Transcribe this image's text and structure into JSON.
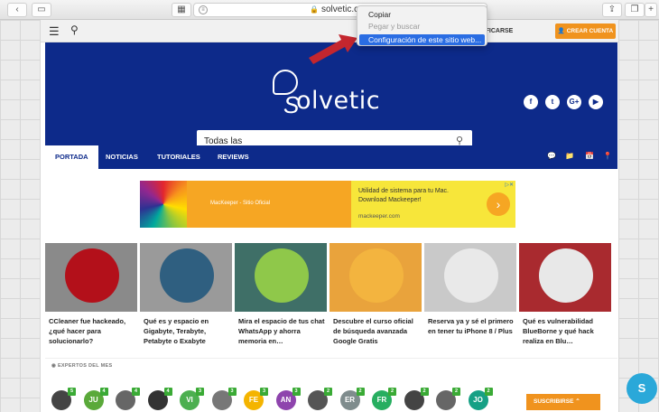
{
  "browser": {
    "url": "solvetic.com",
    "context_menu": {
      "items": [
        {
          "label": "Copiar",
          "state": "normal"
        },
        {
          "label": "Pegar y buscar",
          "state": "disabled"
        },
        {
          "label": "Configuración de este sitio web...",
          "state": "highlighted"
        }
      ]
    }
  },
  "topbar": {
    "login_label": "IDENTIFICARSE",
    "register_label": "CREAR CUENTA"
  },
  "hero": {
    "logo_text": "olvetic",
    "logo_initial": "S",
    "search_value": "Todas las",
    "social": [
      {
        "icon": "facebook-icon",
        "glyph": "f"
      },
      {
        "icon": "twitter-icon",
        "glyph": "t"
      },
      {
        "icon": "googleplus-icon",
        "glyph": "G+"
      },
      {
        "icon": "youtube-icon",
        "glyph": "▶"
      }
    ]
  },
  "nav": {
    "items": [
      "PORTADA",
      "NOTICIAS",
      "TUTORIALES",
      "REVIEWS"
    ]
  },
  "ad": {
    "brand": "MacKeeper - Sitio Oficial",
    "line1": "Utilidad de sistema para tu Mac.",
    "line2": "Download Mackeeper!",
    "line3": "mackeeper.com",
    "arrow": "›"
  },
  "cards": [
    {
      "title": "CCleaner fue hackeado, ¿qué hacer para solucionarlo?",
      "bg": "#8a8a8a",
      "circle": "#b3101a"
    },
    {
      "title": "Qué es y espacio en Gigabyte, Terabyte, Petabyte o Exabyte",
      "bg": "#9a9a9a",
      "circle": "#2f5f80"
    },
    {
      "title": "Mira el espacio de tus chat WhatsApp y ahorra memoria en…",
      "bg": "#3f6f67",
      "circle": "#8fc84a"
    },
    {
      "title": "Descubre el curso oficial de búsqueda avanzada Google Gratis",
      "bg": "#e9a33c",
      "circle": "#f3b43f"
    },
    {
      "title": "Reserva ya y sé el primero en tener tu iPhone 8 / Plus",
      "bg": "#c9c9c9",
      "circle": "#e9e9e9"
    },
    {
      "title": "Qué es vulnerabilidad BlueBorne y qué hack realiza en Blu…",
      "bg": "#a92a2f",
      "circle": "#e8e8e8"
    }
  ],
  "experts": {
    "title": "EXPERTOS DEL MES",
    "members": [
      {
        "initials": "",
        "color": "#444",
        "count": "5"
      },
      {
        "initials": "JU",
        "color": "#5aa93a",
        "count": "4"
      },
      {
        "initials": "",
        "color": "#666",
        "count": "4"
      },
      {
        "initials": "",
        "color": "#333",
        "count": "4"
      },
      {
        "initials": "VI",
        "color": "#4caf50",
        "count": "3"
      },
      {
        "initials": "",
        "color": "#777",
        "count": "3"
      },
      {
        "initials": "FE",
        "color": "#f4b400",
        "count": "3"
      },
      {
        "initials": "AN",
        "color": "#8e44ad",
        "count": "3"
      },
      {
        "initials": "",
        "color": "#555",
        "count": "2"
      },
      {
        "initials": "ER",
        "color": "#7f8c8d",
        "count": "2"
      },
      {
        "initials": "FR",
        "color": "#27ae60",
        "count": "2"
      },
      {
        "initials": "",
        "color": "#444",
        "count": "2"
      },
      {
        "initials": "",
        "color": "#666",
        "count": "2"
      },
      {
        "initials": "JO",
        "color": "#16a085",
        "count": "2"
      }
    ],
    "subscribe_label": "SUSCRIBIRSE"
  }
}
